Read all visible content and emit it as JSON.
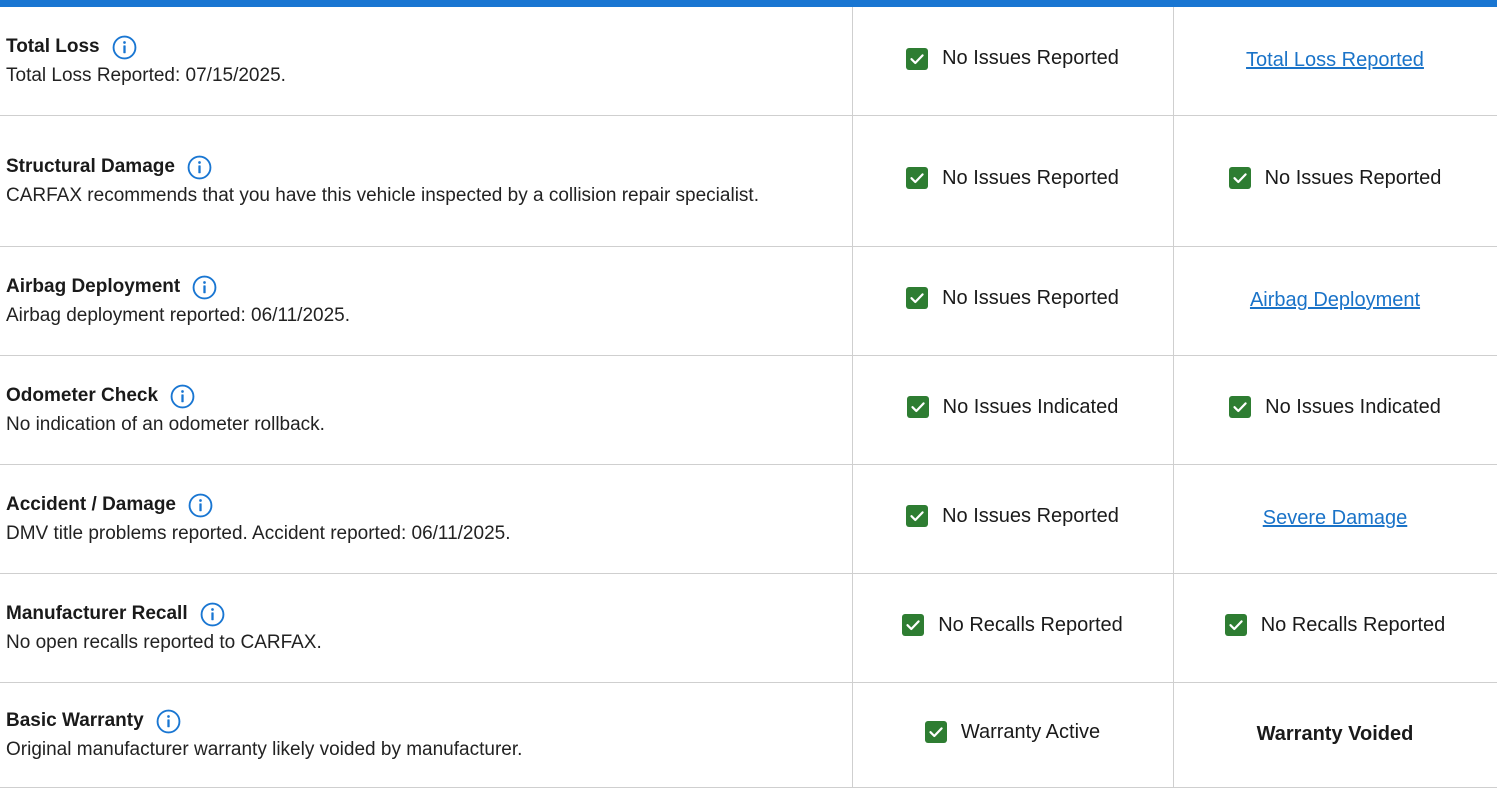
{
  "colors": {
    "accent_bar": "#1976d2",
    "check_green": "#2e7d32",
    "link_blue": "#1a73c8",
    "info_blue": "#1976d2"
  },
  "rows": [
    {
      "title": "Total Loss",
      "description": "Total Loss Reported: 07/15/2025.",
      "col_b": {
        "type": "check",
        "text": "No Issues Reported"
      },
      "col_c": {
        "type": "link",
        "text": "Total Loss Reported"
      }
    },
    {
      "title": "Structural Damage",
      "description": "CARFAX recommends that you have this vehicle inspected by a collision repair specialist.",
      "col_b": {
        "type": "check",
        "text": "No Issues Reported"
      },
      "col_c": {
        "type": "check",
        "text": "No Issues Reported"
      }
    },
    {
      "title": "Airbag Deployment",
      "description": "Airbag deployment reported: 06/11/2025.",
      "col_b": {
        "type": "check",
        "text": "No Issues Reported"
      },
      "col_c": {
        "type": "link",
        "text": "Airbag Deployment"
      }
    },
    {
      "title": "Odometer Check",
      "description": "No indication of an odometer rollback.",
      "col_b": {
        "type": "check",
        "text": "No Issues Indicated"
      },
      "col_c": {
        "type": "check",
        "text": "No Issues Indicated"
      }
    },
    {
      "title": "Accident / Damage",
      "description": "DMV title problems reported. Accident reported: 06/11/2025.",
      "col_b": {
        "type": "check",
        "text": "No Issues Reported"
      },
      "col_c": {
        "type": "link",
        "text": "Severe Damage"
      }
    },
    {
      "title": "Manufacturer Recall",
      "description": "No open recalls reported to CARFAX.",
      "col_b": {
        "type": "check",
        "text": "No Recalls Reported"
      },
      "col_c": {
        "type": "check",
        "text": "No Recalls Reported"
      }
    },
    {
      "title": "Basic Warranty",
      "description": "Original manufacturer warranty likely voided by manufacturer.",
      "col_b": {
        "type": "check",
        "text": "Warranty Active"
      },
      "col_c": {
        "type": "bold",
        "text": "Warranty Voided"
      }
    }
  ]
}
